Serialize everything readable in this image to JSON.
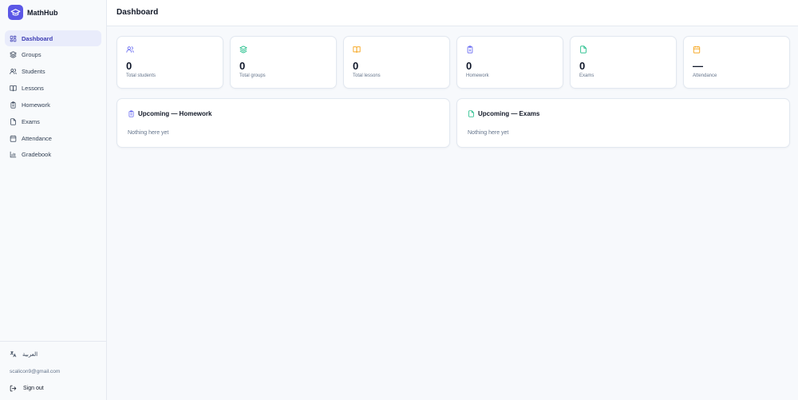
{
  "app": {
    "name": "MathHub",
    "accent": "#5b57e6"
  },
  "sidebar": {
    "items": [
      {
        "label": "Dashboard",
        "icon": "dashboard-icon",
        "active": true
      },
      {
        "label": "Groups",
        "icon": "layers-icon"
      },
      {
        "label": "Students",
        "icon": "users-icon"
      },
      {
        "label": "Lessons",
        "icon": "book-open-icon"
      },
      {
        "label": "Homework",
        "icon": "clipboard-icon"
      },
      {
        "label": "Exams",
        "icon": "file-icon"
      },
      {
        "label": "Attendance",
        "icon": "calendar-icon"
      },
      {
        "label": "Gradebook",
        "icon": "bar-chart-icon"
      }
    ],
    "language": "العربية",
    "email": "scalicon9@gmail.com",
    "signout": "Sign out"
  },
  "header": {
    "title": "Dashboard"
  },
  "stats": [
    {
      "value": "0",
      "label": "Total students",
      "icon": "users-icon",
      "color": "#6366f1"
    },
    {
      "value": "0",
      "label": "Total groups",
      "icon": "layers-icon",
      "color": "#10b981"
    },
    {
      "value": "0",
      "label": "Total lessons",
      "icon": "book-open-icon",
      "color": "#f59e0b"
    },
    {
      "value": "0",
      "label": "Homework",
      "icon": "clipboard-icon",
      "color": "#6366f1"
    },
    {
      "value": "0",
      "label": "Exams",
      "icon": "file-icon",
      "color": "#10b981"
    },
    {
      "value": "—",
      "label": "Attendance",
      "icon": "calendar-icon",
      "color": "#f59e0b"
    }
  ],
  "panels": [
    {
      "title": "Upcoming — Homework",
      "empty": "Nothing here yet",
      "icon": "clipboard-icon",
      "color": "#6366f1"
    },
    {
      "title": "Upcoming — Exams",
      "empty": "Nothing here yet",
      "icon": "file-icon",
      "color": "#10b981"
    }
  ]
}
